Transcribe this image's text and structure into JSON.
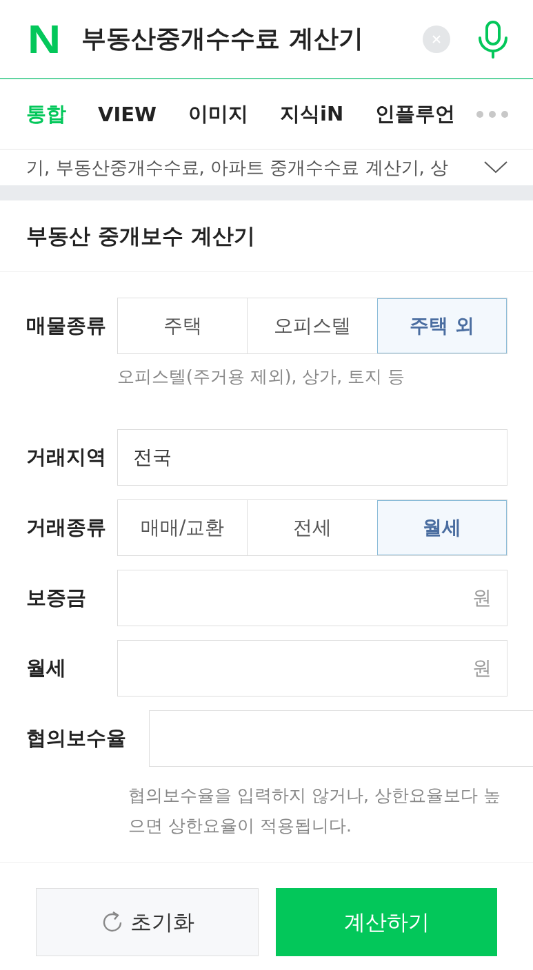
{
  "search_bar": {
    "logo": "N",
    "query": "부동산중개수수료 계산기"
  },
  "tabs": [
    {
      "label": "통합",
      "selected": true
    },
    {
      "label": "VIEW",
      "selected": false
    },
    {
      "label": "이미지",
      "selected": false
    },
    {
      "label": "지식iN",
      "selected": false
    },
    {
      "label": "인플루언",
      "selected": false
    }
  ],
  "related_keywords": "기, 부동산중개수수료, 아파트 중개수수료 계산기, 상",
  "calculator": {
    "title": "부동산 중개보수 계산기",
    "fields": [
      {
        "kind": "segmented",
        "label": "매물종류",
        "options": [
          {
            "label": "주택",
            "selected": false
          },
          {
            "label": "오피스텔",
            "selected": false
          },
          {
            "label": "주택 외",
            "selected": true
          }
        ],
        "hint": "오피스텔(주거용 제외), 상가, 토지 등"
      },
      {
        "kind": "text",
        "label": "거래지역",
        "value": "전국"
      },
      {
        "kind": "segmented",
        "label": "거래종류",
        "options": [
          {
            "label": "매매/교환",
            "selected": false
          },
          {
            "label": "전세",
            "selected": false
          },
          {
            "label": "월세",
            "selected": true
          }
        ]
      },
      {
        "kind": "amount",
        "label": "보증금",
        "unit": "원"
      },
      {
        "kind": "amount",
        "label": "월세",
        "unit": "원"
      },
      {
        "kind": "rate",
        "label": "협의보수율",
        "hint": "협의보수율을 입력하지 않거나, 상한요율보다 높으면 상한요율이 적용됩니다."
      }
    ],
    "buttons": [
      {
        "kind": "reset",
        "label": "초기화"
      },
      {
        "kind": "primary",
        "label": "계산하기"
      }
    ]
  }
}
